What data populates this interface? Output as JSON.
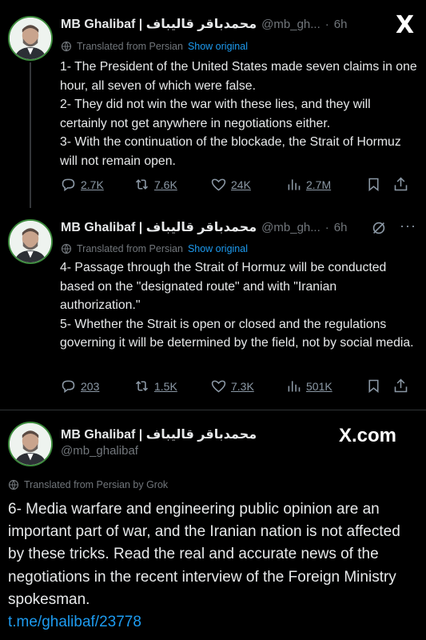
{
  "tweets": [
    {
      "name": "MB Ghalibaf | محمدباقر قالیباف",
      "handle": "@mb_gh...",
      "time": "6h",
      "translated_label": "Translated from Persian",
      "show_original": "Show original",
      "body": "1- The President of the United States made seven claims in one hour, all seven of which were false.\n2- They did not win the war with these lies, and they will certainly not get anywhere in negotiations either.\n3- With the continuation of the blockade, the Strait of Hormuz will not remain open.",
      "replies": "2.7K",
      "reposts": "7.6K",
      "likes": "24K",
      "views": "2.7M"
    },
    {
      "name": "MB Ghalibaf | محمدباقر قالیباف",
      "handle": "@mb_gh...",
      "time": "6h",
      "translated_label": "Translated from Persian",
      "show_original": "Show original",
      "body": "4- Passage through the Strait of Hormuz will be conducted based on the \"designated route\" and with \"Iranian authorization.\"\n5- Whether the Strait is open or closed and the regulations governing it will be determined by the field, not by social media.",
      "replies": "203",
      "reposts": "1.5K",
      "likes": "7.3K",
      "views": "501K"
    }
  ],
  "main_tweet": {
    "name": "MB Ghalibaf | محمدباقر قالیباف",
    "handle": "@mb_ghalibaf",
    "translated_label": "Translated from Persian by Grok",
    "body": "6- Media warfare and engineering public opinion are an important part of war, and the Iranian nation is not affected by these tricks. Read the real and accurate news of the negotiations in the recent interview of the Foreign Ministry spokesman.",
    "link": "t.me/ghalibaf/23778"
  },
  "branding": {
    "x_logo": "X",
    "x_com": "X.com"
  },
  "colors": {
    "background": "#000000",
    "text": "#e7e9ea",
    "secondary": "#71767b",
    "link": "#1d9bf0"
  }
}
